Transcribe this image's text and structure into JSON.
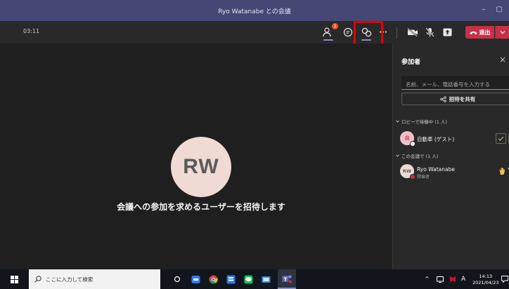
{
  "window": {
    "title": "Ryo Watanabe との会議",
    "minimize_glyph": "–",
    "restore_glyph": "▢"
  },
  "toolbar": {
    "timer": "03:11",
    "participants_badge": "1",
    "more_glyph": "···",
    "leave_label": "退出"
  },
  "stage": {
    "avatar_initials": "RW",
    "invite_message": "会議への参加を求めるユーザーを招待します"
  },
  "participants_panel": {
    "title": "参加者",
    "close_glyph": "×",
    "search_placeholder": "名前、メール、電話番号を入力する",
    "share_invite_label": "招待を共有",
    "lobby_section": "ロビーで待機中 (1 人)",
    "meeting_section": "この会議で (1 人)",
    "lobby_participants": [
      {
        "name": "自動車 (ゲスト)",
        "initial": "自",
        "avatar_color": "#f4c0c8"
      }
    ],
    "meeting_participants": [
      {
        "name": "Ryo Watanabe",
        "role": "開催者",
        "initials": "RW",
        "avatar_color": "#efdbd3"
      }
    ]
  },
  "taskbar": {
    "search_placeholder": "ここに入力して検索",
    "ime_indicator": "A",
    "time": "14:13",
    "date": "2021/04/23"
  },
  "colors": {
    "titlebar": "#464775",
    "accent": "#8b8cc7",
    "leave": "#c4314b",
    "highlight": "#e00000",
    "badge": "#e0592a"
  },
  "icons": [
    "people-icon",
    "chat-icon",
    "reactions-icon",
    "more-icon",
    "camera-off-icon",
    "mic-off-icon",
    "share-icon",
    "phone-icon",
    "chevron-down-icon",
    "share-link-icon",
    "check-icon",
    "deny-icon",
    "raise-hand-icon",
    "windows-start-icon",
    "search-icon"
  ]
}
